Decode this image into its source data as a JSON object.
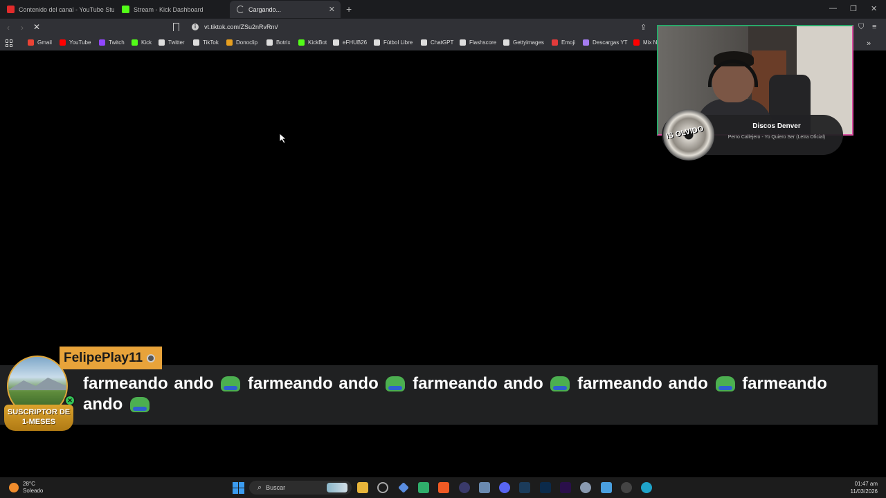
{
  "browser": {
    "tabs": [
      {
        "label": "Contenido del canal - YouTube Studio",
        "color": "#e22b2b",
        "active": false
      },
      {
        "label": "Stream - Kick Dashboard",
        "color": "#53fc18",
        "active": false
      },
      {
        "label": "Cargando...",
        "color": "#9a9a9a",
        "active": true
      }
    ],
    "url": "vt.tiktok.com/ZSu2nRvRm/",
    "bookmarks": [
      "Gmail",
      "YouTube",
      "Twitch",
      "Kick",
      "Twitter",
      "TikTok",
      "Donoclip",
      "Botrix",
      "KickBot",
      "eFHUB26",
      "Fútbol Libre",
      "ChatGPT",
      "Flashscore",
      "Gettyimages",
      "Emoji",
      "Descargas YT",
      "Mix N"
    ],
    "bookmark_colors": [
      "#ea4335",
      "#ff0000",
      "#9146ff",
      "#53fc18",
      "#dddddd",
      "#dddddd",
      "#e8a020",
      "#dddddd",
      "#53fc18",
      "#dddddd",
      "#dddddd",
      "#dddddd",
      "#dddddd",
      "#dddddd",
      "#e23b3b",
      "#a47cf0",
      "#ff0000"
    ]
  },
  "overlay": {
    "now_playing": {
      "artist": "Discos Denver",
      "song": "Perro Callejero - Yo Quiero Ser (Letra Oficial)",
      "disc_text": "IS OLVIDO"
    },
    "chat": {
      "username": "FelipePlay11",
      "badge": "SUSCRIPTOR DE 1-MESES",
      "message_word": "farmeando ando",
      "repeat_count": 5
    }
  },
  "taskbar": {
    "weather_temp": "28°C",
    "weather_desc": "Soleado",
    "search_placeholder": "Buscar",
    "time": "01:47 am",
    "date": "11/03/2026"
  }
}
